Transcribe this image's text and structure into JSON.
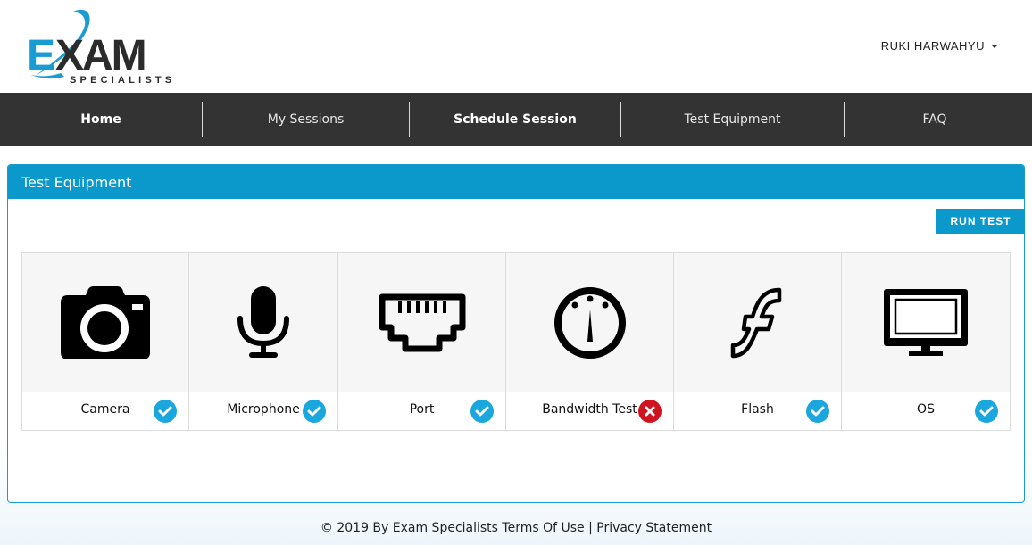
{
  "header": {
    "logo_text": "EXAM",
    "logo_subtext": "SPECIALISTS",
    "user_name": "RUKI HARWAHYU"
  },
  "nav": [
    {
      "label": "Home"
    },
    {
      "label": "My Sessions"
    },
    {
      "label": "Schedule Session"
    },
    {
      "label": "Test Equipment"
    },
    {
      "label": "FAQ"
    }
  ],
  "panel": {
    "title": "Test Equipment",
    "run_test_label": "RUN TEST",
    "items": [
      {
        "label": "Camera",
        "icon": "camera-icon",
        "status": "pass"
      },
      {
        "label": "Microphone",
        "icon": "microphone-icon",
        "status": "pass"
      },
      {
        "label": "Port",
        "icon": "ethernet-port-icon",
        "status": "pass"
      },
      {
        "label": "Bandwidth Test",
        "icon": "speedometer-icon",
        "status": "fail"
      },
      {
        "label": "Flash",
        "icon": "flash-icon",
        "status": "pass"
      },
      {
        "label": "OS",
        "icon": "monitor-icon",
        "status": "pass"
      }
    ]
  },
  "footer": {
    "copyright": "© 2019 By Exam Specialists",
    "terms": "Terms Of Use",
    "separator": "|",
    "privacy": "Privacy Statement"
  },
  "colors": {
    "accent": "#0b99cc",
    "nav_bg": "#333333",
    "pass": "#1aa7dd",
    "fail": "#d0141f"
  }
}
